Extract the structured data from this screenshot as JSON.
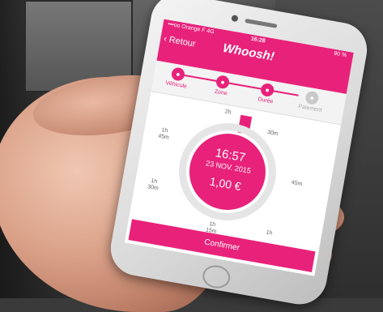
{
  "status": {
    "carrier": "•••oo Orange F 4G",
    "time": "16:28",
    "battery": "90 %"
  },
  "header": {
    "back_label": "Retour",
    "logo_text": "Whoosh!"
  },
  "steps": [
    {
      "label": "Véhicule",
      "active": true
    },
    {
      "label": "Zone",
      "active": true
    },
    {
      "label": "Durée",
      "active": true
    },
    {
      "label": "Paiement",
      "active": false
    }
  ],
  "dial": {
    "time": "16:57",
    "date": "23 NOV. 2015",
    "price": "1,00 €",
    "labels": {
      "l_30m": "30m",
      "l_45m": "45m",
      "l_1h": "1h",
      "l_1h15": "1h\n15m",
      "l_1h30": "1h\n30m",
      "l_1h45": "1h\n45m",
      "l_2h": "2h"
    }
  },
  "actions": {
    "confirm_label": "Confirmer"
  },
  "colors": {
    "brand": "#e8227a"
  }
}
